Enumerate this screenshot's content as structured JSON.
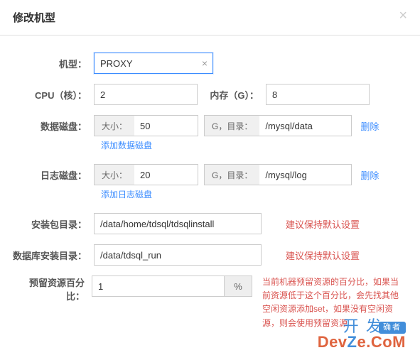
{
  "modal": {
    "title": "修改机型"
  },
  "form": {
    "type_label": "机型：",
    "type_value": "PROXY",
    "cpu_label": "CPU（核）：",
    "cpu_value": "2",
    "mem_label": "内存（G）：",
    "mem_value": "8",
    "data_disk_label": "数据磁盘：",
    "size_addon": "大小：",
    "unit_addon": "G，目录：",
    "data_disk_size": "50",
    "data_disk_dir": "/mysql/data",
    "delete_label": "删除",
    "add_data_disk": "添加数据磁盘",
    "log_disk_label": "日志磁盘：",
    "log_disk_size": "20",
    "log_disk_dir": "/mysql/log",
    "add_log_disk": "添加日志磁盘",
    "install_pkg_label": "安装包目录：",
    "install_pkg_value": "/data/home/tdsql/tdsqlinstall",
    "db_install_label": "数据库安装目录：",
    "db_install_value": "/data/tdsql_run",
    "keep_default_hint": "建议保持默认设置",
    "reserve_label": "预留资源百分比：",
    "reserve_value": "1",
    "percent_sign": "%",
    "reserve_hint": "当前机器预留资源的百分比，如果当前资源低于这个百分比，会先找其他空闲资源添加set，如果没有空闲资源，则会使用预留资源"
  },
  "watermark": {
    "top": "开 发",
    "badge": "确者",
    "bottom_dev": "Dev",
    "bottom_z": "Z",
    "bottom_com": "e.CoM"
  }
}
